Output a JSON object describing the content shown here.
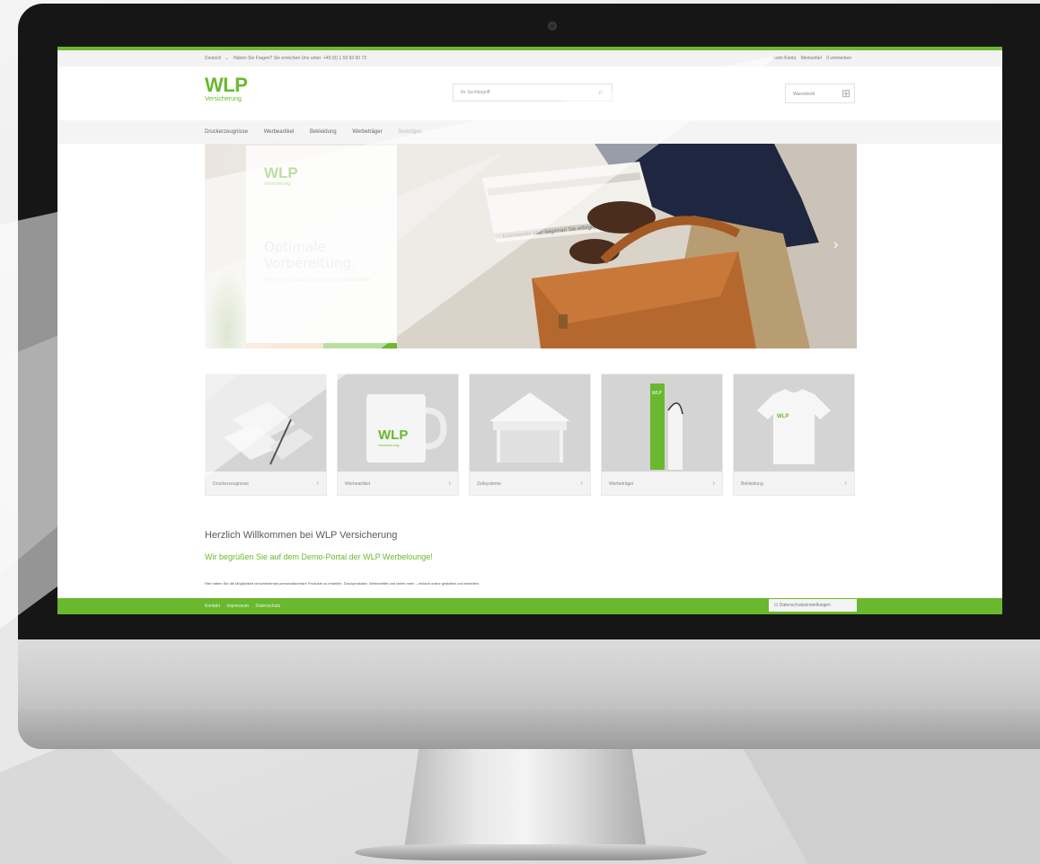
{
  "topbar": {
    "language": "Deutsch",
    "contact": "Haben Sie Fragen? Sie erreichen Uns unter: +49 (0) 1 59 93 90 73",
    "my_account": "Mein Konto",
    "wishlist": "Merkzettel",
    "compare": "0 vormerken"
  },
  "header": {
    "logo": "WLP",
    "logo_sub": "Versicherung",
    "search_placeholder": "Ihr Suchbegriff",
    "cart_label": "Warenkorb"
  },
  "nav": {
    "items": [
      "Druckerzeugnisse",
      "Werbeartikel",
      "Bekleidung",
      "Werbeträger",
      "Sonstiges"
    ]
  },
  "hero": {
    "card_logo": "WLP",
    "card_logo_sub": "Versicherung",
    "headline": "Optimale Vorbereitung.",
    "text": "Immer und überall bestens ausgestattet sein.",
    "newspaper_text": "Kommentar: Hier beginnen Sie erfolgreich"
  },
  "categories": [
    {
      "label": "Druckerzeugnisse",
      "icon": "stationery-icon"
    },
    {
      "label": "Werbeartikel",
      "icon": "mug-icon"
    },
    {
      "label": "Zeltsysteme",
      "icon": "tent-icon"
    },
    {
      "label": "Werbeträger",
      "icon": "beachflag-icon"
    },
    {
      "label": "Bekleidung",
      "icon": "tshirt-icon"
    }
  ],
  "mug_text": "WLP",
  "mug_sub": "Versicherung",
  "flag_text": "WLP",
  "shirt_text": "WLP",
  "welcome": {
    "title": "Herzlich Willkommen bei WLP Versicherung",
    "subtitle": "Wir begrüßen Sie auf dem Demo-Portal der WLP Werbelounge!",
    "text": "Hier haben Sie die Möglichkeit verschiedenste personalisierbare Produkte zu erstellen. Druckprodukte, Werbemittel und vieles mehr – einfach online gestalten und bestellen."
  },
  "footer": {
    "links": [
      "Kontakt",
      "Impressum",
      "Datenschutz"
    ],
    "button": "Datenschutzeinstellungen"
  },
  "colors": {
    "brand_green": "#6ab82e",
    "bezel": "#161616"
  }
}
